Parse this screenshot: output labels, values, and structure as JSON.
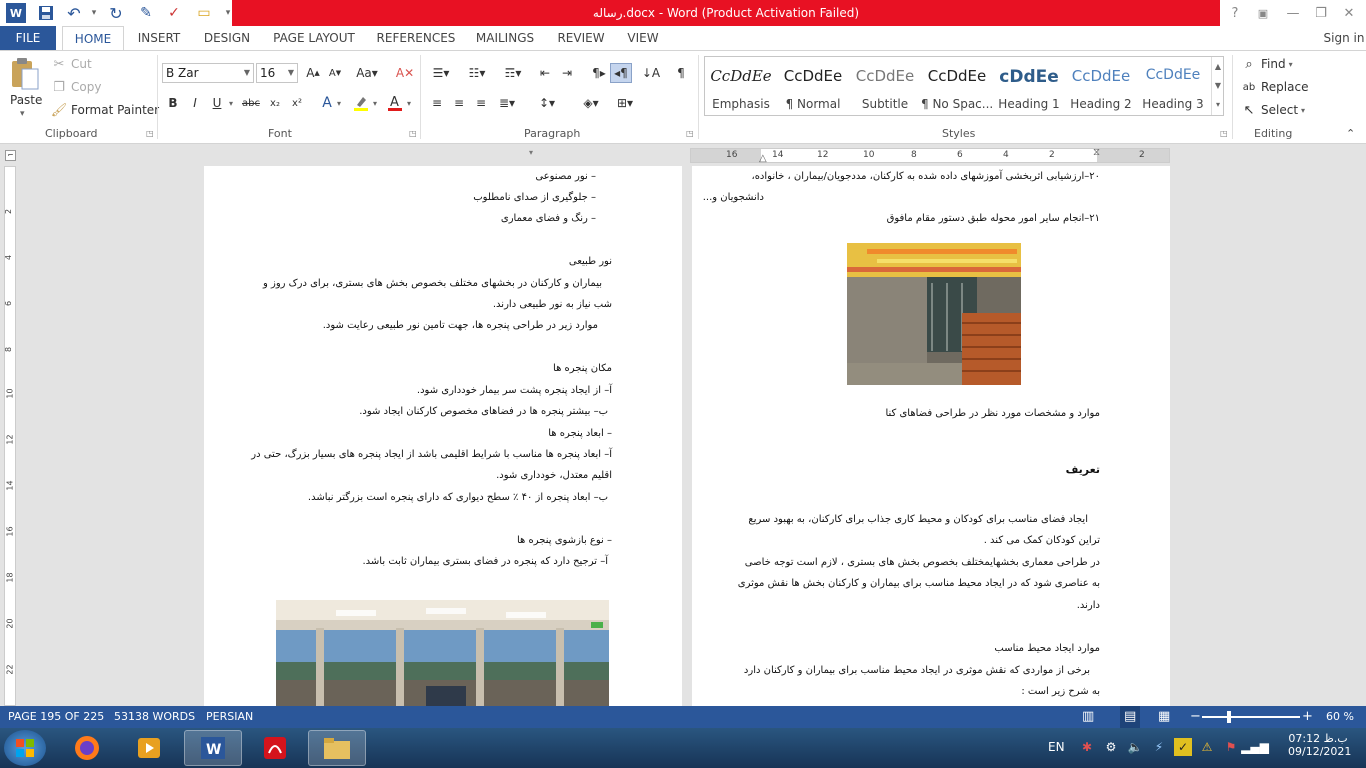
{
  "window": {
    "title": "رساله.docx - Word (Product Activation Failed)"
  },
  "controls": {
    "help": "?",
    "minimize": "—",
    "restore": "❐",
    "close": "✕"
  },
  "tabs": [
    "FILE",
    "HOME",
    "INSERT",
    "DESIGN",
    "PAGE LAYOUT",
    "REFERENCES",
    "MAILINGS",
    "REVIEW",
    "VIEW"
  ],
  "signin": "Sign in",
  "clipboard": {
    "paste": "Paste",
    "cut": "Cut",
    "copy": "Copy",
    "format_painter": "Format Painter",
    "label": "Clipboard"
  },
  "font": {
    "name": "B Zar",
    "size": "16",
    "label": "Font"
  },
  "paragraph": {
    "label": "Paragraph"
  },
  "styles": {
    "label": "Styles",
    "items": [
      {
        "sample": "CcDdEe",
        "name": "Emphasis"
      },
      {
        "sample": "CcDdEe",
        "name": "¶ Normal"
      },
      {
        "sample": "CcDdEe",
        "name": "Subtitle"
      },
      {
        "sample": "CcDdEe",
        "name": "¶ No Spac..."
      },
      {
        "sample": "cDdEe",
        "name": "Heading 1"
      },
      {
        "sample": "CcDdEe",
        "name": "Heading 2"
      },
      {
        "sample": "CcDdEe",
        "name": "Heading 3"
      }
    ]
  },
  "editing": {
    "find": "Find",
    "replace": "Replace",
    "select": "Select",
    "label": "Editing"
  },
  "ruler": {
    "ticks": [
      "16",
      "14",
      "12",
      "10",
      "8",
      "6",
      "4",
      "2",
      "2"
    ]
  },
  "vruler": {
    "ticks": [
      "2",
      "4",
      "6",
      "8",
      "10",
      "12",
      "14",
      "16",
      "18",
      "20",
      "22"
    ]
  },
  "page1": {
    "lines": [
      "–   نور مصنوعی",
      "–   جلوگیری از صدای نامطلوب",
      "–   رنگ و فضای معماری",
      "نور طبیعی",
      "بیماران و کارکنان در بخشهای مختلف بخصوص بخش های بستری، برای درک روز و",
      "شب نیاز به نور طبیعی دارند.",
      "موارد زیر در طراحی پنجره ها، جهت تامین نور طبیعی رعایت شود.",
      "مکان پنجره ها",
      "آ– از ایجاد پنجره پشت سر بیمار خودداری شود.",
      "ب– بیشتر پنجره ها در فضاهای مخصوص کارکنان ایجاد شود.",
      "– ابعاد پنجره ها",
      "آ– ابعاد پنجره ها مناسب با شرایط اقلیمی باشد از ایجاد پنجره های بسیار بزرگ، حتی در",
      "اقلیم معتدل، خودداری شود.",
      "ب– ابعاد پنجره از ۴۰ ٪ سطح دیواری که دارای پنجره است بزرگتر نباشد.",
      "– نوع بازشوی پنجره ها",
      "آ– ترجیح دارد که پنجره در فضای بستری بیماران ثابت باشد."
    ]
  },
  "page2": {
    "lines": [
      "۲۰–ارزشیابی اثربخشی آموزشهای داده شده به کارکنان، مددجویان/بیماران ، خانواده،",
      "دانشجویان و...",
      "۲۱–انجام سایر امور محوله طبق دستور مقام مافوق",
      "موارد و مشخصات مورد نظر در طراحی فضاهای کنا",
      "تعریف",
      "ایجاد فضای مناسب برای کودکان و محیط کاری جذاب برای کارکنان، به بهبود سریع",
      "تراین کودکان کمک می کند .",
      "در طراحی معماری بخشهایمختلف بخصوص بخش های بستری ، لازم است توجه خاصی",
      "به عناصری شود که در ایجاد محیط مناسب برای بیماران و کارکنان بخش ها نقش موثری",
      "دارند.",
      "موارد ایجاد محیط مناسب",
      "برخی از مواردی که نقش موثری در ایجاد محیط مناسب برای بیماران و کارکنان دارد",
      "به شرح زیر است :"
    ]
  },
  "status": {
    "page": "PAGE 195 OF 225",
    "words": "53138 WORDS",
    "language": "PERSIAN",
    "zoom": "60 %",
    "zoom_level": 0.6
  },
  "taskbar": {
    "lang": "EN",
    "time": "07:12 ب.ظ",
    "date": "09/12/2021"
  },
  "colors": {
    "accent": "#2b579a",
    "title_bar": "#e81123"
  }
}
